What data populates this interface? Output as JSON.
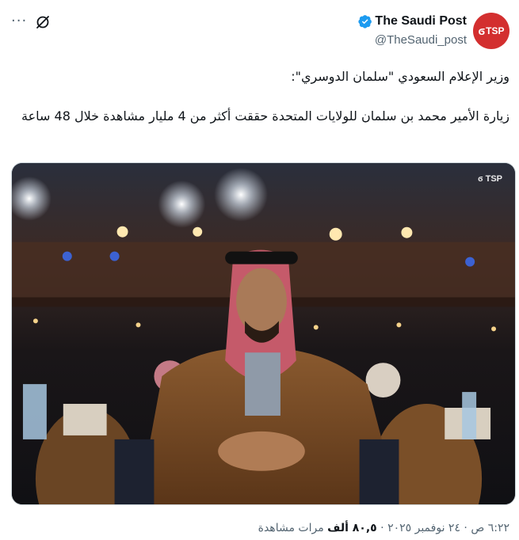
{
  "account": {
    "display_name": "The Saudi Post",
    "handle": "@TheSaudi_post",
    "avatar_text": "TSP",
    "verified": true,
    "avatar_color": "#d32f2f",
    "badge_color": "#1d9bf0"
  },
  "header": {
    "more_label": "···"
  },
  "tweet": {
    "lines": [
      "وزير الإعلام السعودي \"سلمان الدوسري\":",
      "زيارة الأمير محمد بن سلمان للولايات المتحدة حققت أكثر من 4 مليار مشاهدة خلال 48 ساعة"
    ]
  },
  "media": {
    "watermark": "TSP",
    "description_icon": "photo"
  },
  "meta": {
    "time": "٦:٢٢ ص",
    "separator": "·",
    "date": "٢٤ نوفمبر ٢٠٢٥",
    "views_count": "٨٠,٥ ألف",
    "views_label": "مرات مشاهدة"
  }
}
